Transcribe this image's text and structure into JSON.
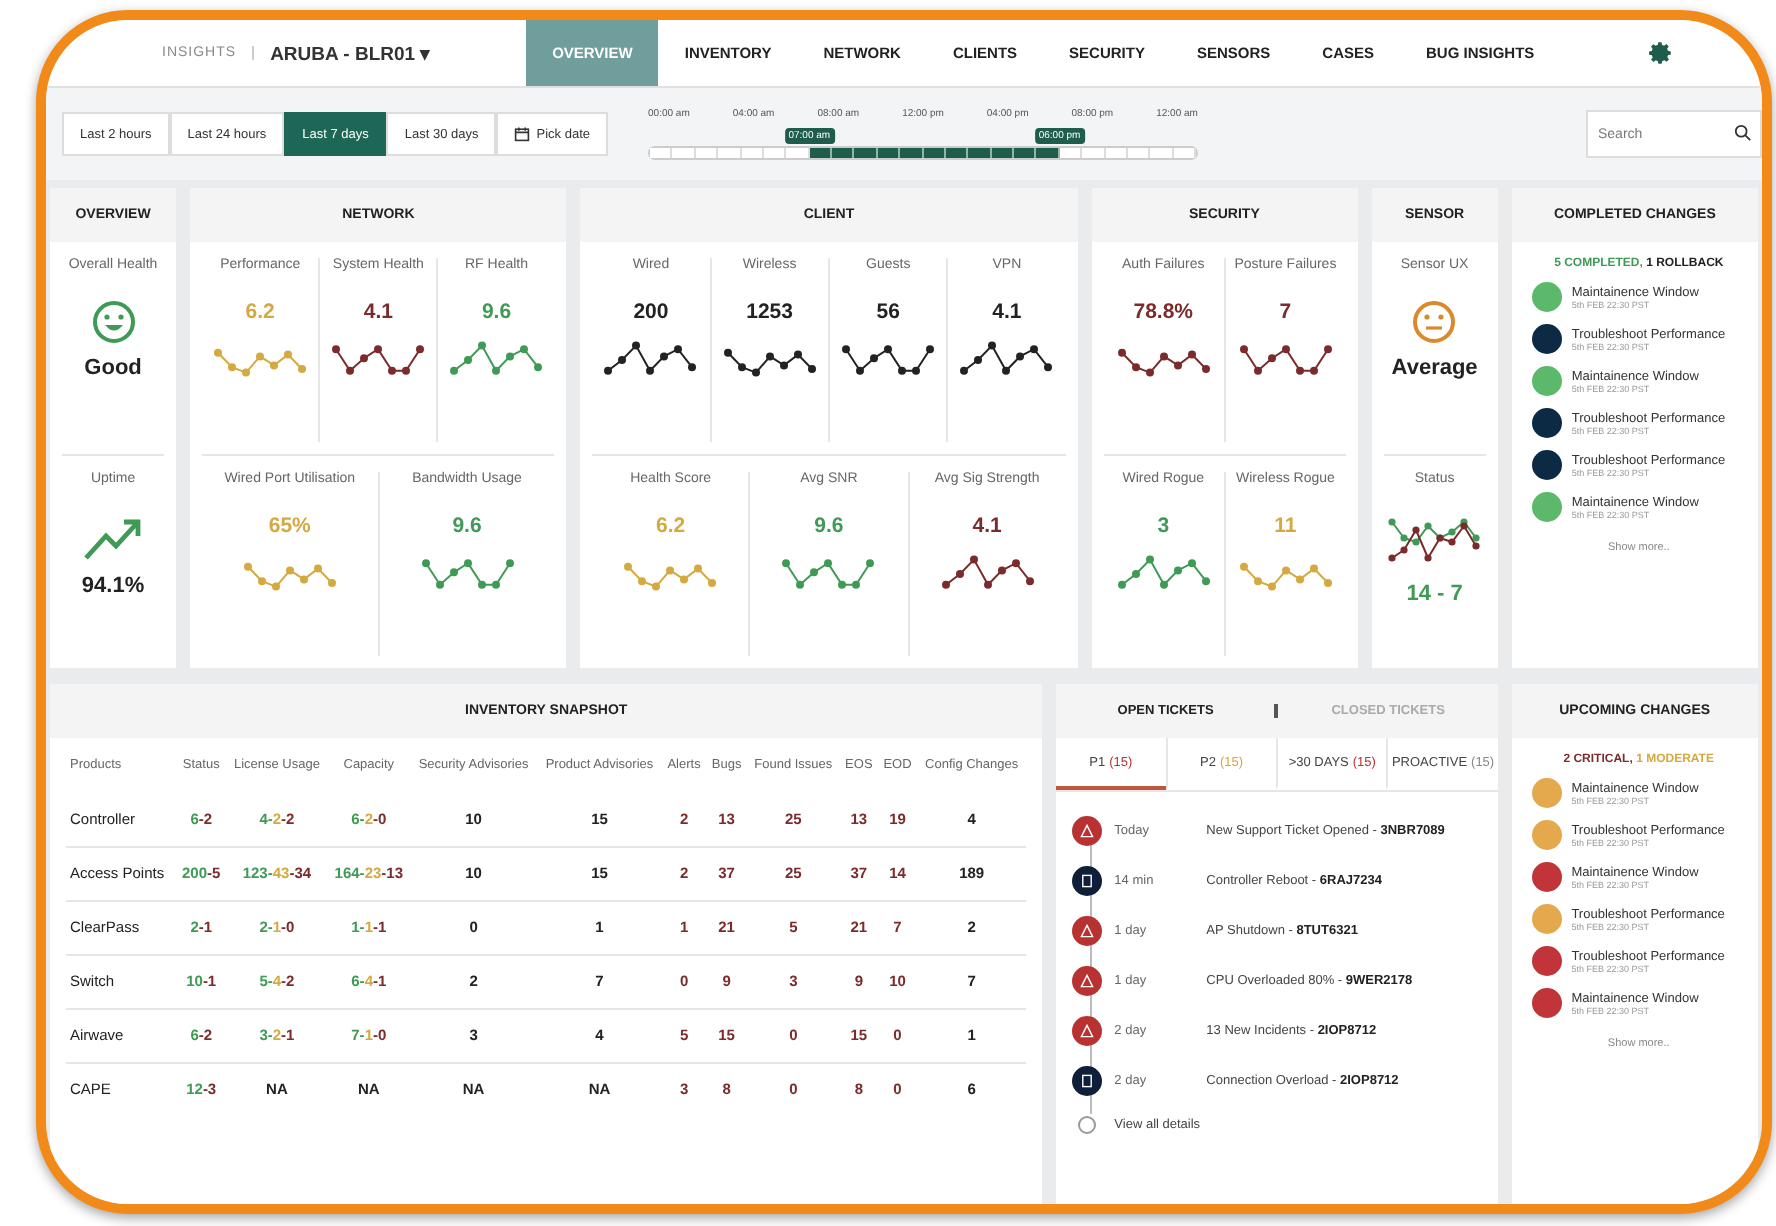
{
  "header": {
    "logo": "INSIGHTS",
    "site": "ARUBA - BLR01 ▾",
    "nav": [
      {
        "label": "OVERVIEW",
        "selected": true
      },
      {
        "label": "INVENTORY",
        "selected": false
      },
      {
        "label": "NETWORK",
        "selected": false
      },
      {
        "label": "CLIENTS",
        "selected": false
      },
      {
        "label": "SECURITY",
        "selected": false
      },
      {
        "label": "SENSORS",
        "selected": false
      },
      {
        "label": "CASES",
        "selected": false
      },
      {
        "label": "BUG INSIGHTS",
        "selected": false
      }
    ]
  },
  "toolbar": {
    "ranges": [
      {
        "label": "Last 2 hours",
        "selected": false
      },
      {
        "label": "Last 24 hours",
        "selected": false
      },
      {
        "label": "Last 7 days",
        "selected": true
      },
      {
        "label": "Last 30 days",
        "selected": false
      }
    ],
    "pick_date": "Pick date",
    "timeline": {
      "labels": [
        "00:00 am",
        "04:00 am",
        "08:00 am",
        "12:00 pm",
        "04:00 pm",
        "08:00 pm",
        "12:00 am"
      ],
      "start": "07:00 am",
      "end": "06:00 pm",
      "slots": [
        {
          "selected": false
        },
        {
          "selected": false
        },
        {
          "selected": false
        },
        {
          "selected": false
        },
        {
          "selected": false
        },
        {
          "selected": false
        },
        {
          "selected": false
        },
        {
          "selected": true
        },
        {
          "selected": true
        },
        {
          "selected": true
        },
        {
          "selected": true
        },
        {
          "selected": true
        },
        {
          "selected": true
        },
        {
          "selected": true
        },
        {
          "selected": true
        },
        {
          "selected": true
        },
        {
          "selected": true
        },
        {
          "selected": true
        },
        {
          "selected": false
        },
        {
          "selected": false
        },
        {
          "selected": false
        },
        {
          "selected": false
        },
        {
          "selected": false
        },
        {
          "selected": false
        }
      ]
    },
    "search": {
      "placeholder": "Search"
    }
  },
  "cards": [
    {
      "title": "OVERVIEW",
      "sections": [
        {
          "metrics": [
            {
              "label": "Overall Health",
              "kind": "face-happy",
              "color": "#3f9a55",
              "value": "Good"
            }
          ]
        },
        {
          "metrics": [
            {
              "label": "Uptime",
              "kind": "trend",
              "color": "#3f9a55",
              "value": "94.1%"
            }
          ]
        }
      ]
    },
    {
      "title": "NETWORK",
      "sections": [
        {
          "metrics": [
            {
              "label": "Performance",
              "kind": "spark",
              "color": "#d4a93f",
              "value": "6.2"
            },
            {
              "label": "System Health",
              "kind": "spark",
              "color": "#7b2b2b",
              "value": "4.1"
            },
            {
              "label": "RF Health",
              "kind": "spark",
              "color": "#3f9a55",
              "value": "9.6"
            }
          ]
        },
        {
          "metrics": [
            {
              "label": "Wired Port Utilisation",
              "kind": "spark",
              "color": "#d4a93f",
              "value": "65%"
            },
            {
              "label": "Bandwidth Usage",
              "kind": "spark",
              "color": "#3f9a55",
              "value": "9.6"
            }
          ]
        }
      ]
    },
    {
      "title": "CLIENT",
      "sections": [
        {
          "metrics": [
            {
              "label": "Wired",
              "kind": "spark",
              "color": "#222222",
              "value": "200"
            },
            {
              "label": "Wireless",
              "kind": "spark",
              "color": "#222222",
              "value": "1253"
            },
            {
              "label": "Guests",
              "kind": "spark",
              "color": "#222222",
              "value": "56"
            },
            {
              "label": "VPN",
              "kind": "spark",
              "color": "#222222",
              "value": "4.1"
            }
          ]
        },
        {
          "metrics": [
            {
              "label": "Health Score",
              "kind": "spark",
              "color": "#d4a93f",
              "value": "6.2"
            },
            {
              "label": "Avg SNR",
              "kind": "spark",
              "color": "#3f9a55",
              "value": "9.6"
            },
            {
              "label": "Avg Sig Strength",
              "kind": "spark",
              "color": "#7b2b2b",
              "value": "4.1"
            }
          ]
        }
      ]
    },
    {
      "title": "SECURITY",
      "sections": [
        {
          "metrics": [
            {
              "label": "Auth Failures",
              "kind": "spark",
              "color": "#7b2b2b",
              "value": "78.8%"
            },
            {
              "label": "Posture Failures",
              "kind": "spark",
              "color": "#7b2b2b",
              "value": "7"
            }
          ]
        },
        {
          "metrics": [
            {
              "label": "Wired Rogue",
              "kind": "spark",
              "color": "#3f9a55",
              "value": "3"
            },
            {
              "label": "Wireless Rogue",
              "kind": "spark",
              "color": "#d4a93f",
              "value": "11"
            }
          ]
        }
      ]
    },
    {
      "title": "SENSOR",
      "sections": [
        {
          "metrics": [
            {
              "label": "Sensor UX",
              "kind": "face-neutral",
              "color": "#d98a2b",
              "value": "Average"
            }
          ]
        },
        {
          "metrics": [
            {
              "label": "Status",
              "kind": "dual",
              "color": "#3f9a55",
              "value": "14 - 7"
            }
          ]
        }
      ]
    }
  ],
  "completed_changes": {
    "title": "COMPLETED CHANGES",
    "summary": [
      {
        "text": "5 COMPLETED,",
        "color": "#3f9a55"
      },
      {
        "text": "1 ROLLBACK",
        "color": "#222222"
      }
    ],
    "items": [
      {
        "title": "Maintainence Window",
        "time": "5th FEB 22:30 PST",
        "color": "#5cb86a"
      },
      {
        "title": "Troubleshoot Performance",
        "time": "5th FEB 22:30 PST",
        "color": "#0d2a45"
      },
      {
        "title": "Maintainence Window",
        "time": "5th FEB 22:30 PST",
        "color": "#5cb86a"
      },
      {
        "title": "Troubleshoot Performance",
        "time": "5th FEB 22:30 PST",
        "color": "#0d2a45"
      },
      {
        "title": "Troubleshoot Performance",
        "time": "5th FEB 22:30 PST",
        "color": "#0d2a45"
      },
      {
        "title": "Maintainence Window",
        "time": "5th FEB 22:30 PST",
        "color": "#5cb86a"
      }
    ],
    "more": "Show more.."
  },
  "inventory": {
    "title": "INVENTORY SNAPSHOT",
    "columns": [
      {
        "label": "Products"
      },
      {
        "label": "Status"
      },
      {
        "label": "License Usage"
      },
      {
        "label": "Capacity"
      },
      {
        "label": "Security Advisories"
      },
      {
        "label": "Product Advisories"
      },
      {
        "label": "Alerts",
        "color": "#7b2b2b"
      },
      {
        "label": "Bugs",
        "color": "#7b2b2b"
      },
      {
        "label": "Found Issues",
        "color": "#7b2b2b"
      },
      {
        "label": "EOS",
        "color": "#7b2b2b"
      },
      {
        "label": "EOD",
        "color": "#7b2b2b"
      },
      {
        "label": "Config Changes"
      }
    ],
    "rows": [
      [
        "Controller",
        [
          {
            "text": "6",
            "color": "#3f9a55"
          },
          {
            "text": "-2",
            "color": "#7b2b2b"
          }
        ],
        [
          {
            "text": "4-",
            "color": "#3f9a55"
          },
          {
            "text": "2",
            "color": "#d4a93f"
          },
          {
            "text": "-2",
            "color": "#7b2b2b"
          }
        ],
        [
          {
            "text": "6-",
            "color": "#3f9a55"
          },
          {
            "text": "2",
            "color": "#d4a93f"
          },
          {
            "text": "-0",
            "color": "#7b2b2b"
          }
        ],
        "10",
        "15",
        "2",
        "13",
        "25",
        "13",
        "19",
        "4"
      ],
      [
        "Access Points",
        [
          {
            "text": "200",
            "color": "#3f9a55"
          },
          {
            "text": "-5",
            "color": "#7b2b2b"
          }
        ],
        [
          {
            "text": "123-",
            "color": "#3f9a55"
          },
          {
            "text": "43",
            "color": "#d4a93f"
          },
          {
            "text": "-34",
            "color": "#7b2b2b"
          }
        ],
        [
          {
            "text": "164-",
            "color": "#3f9a55"
          },
          {
            "text": "23",
            "color": "#d4a93f"
          },
          {
            "text": "-13",
            "color": "#7b2b2b"
          }
        ],
        "10",
        "15",
        "2",
        "37",
        "25",
        "37",
        "14",
        "189"
      ],
      [
        "ClearPass",
        [
          {
            "text": "2",
            "color": "#3f9a55"
          },
          {
            "text": "-1",
            "color": "#7b2b2b"
          }
        ],
        [
          {
            "text": "2-",
            "color": "#3f9a55"
          },
          {
            "text": "1",
            "color": "#d4a93f"
          },
          {
            "text": "-0",
            "color": "#7b2b2b"
          }
        ],
        [
          {
            "text": "1-",
            "color": "#3f9a55"
          },
          {
            "text": "1",
            "color": "#d4a93f"
          },
          {
            "text": "-1",
            "color": "#7b2b2b"
          }
        ],
        "0",
        "1",
        "1",
        "21",
        "5",
        "21",
        "7",
        "2"
      ],
      [
        "Switch",
        [
          {
            "text": "10",
            "color": "#3f9a55"
          },
          {
            "text": "-1",
            "color": "#7b2b2b"
          }
        ],
        [
          {
            "text": "5-",
            "color": "#3f9a55"
          },
          {
            "text": "4",
            "color": "#d4a93f"
          },
          {
            "text": "-2",
            "color": "#7b2b2b"
          }
        ],
        [
          {
            "text": "6-",
            "color": "#3f9a55"
          },
          {
            "text": "4",
            "color": "#d4a93f"
          },
          {
            "text": "-1",
            "color": "#7b2b2b"
          }
        ],
        "2",
        "7",
        "0",
        "9",
        "3",
        "9",
        "10",
        "7"
      ],
      [
        "Airwave",
        [
          {
            "text": "6",
            "color": "#3f9a55"
          },
          {
            "text": "-2",
            "color": "#7b2b2b"
          }
        ],
        [
          {
            "text": "3-",
            "color": "#3f9a55"
          },
          {
            "text": "2",
            "color": "#d4a93f"
          },
          {
            "text": "-1",
            "color": "#7b2b2b"
          }
        ],
        [
          {
            "text": "7-",
            "color": "#3f9a55"
          },
          {
            "text": "1",
            "color": "#d4a93f"
          },
          {
            "text": "-0",
            "color": "#7b2b2b"
          }
        ],
        "3",
        "4",
        "5",
        "15",
        "0",
        "15",
        "0",
        "1"
      ],
      [
        "CAPE",
        [
          {
            "text": "12",
            "color": "#3f9a55"
          },
          {
            "text": "-3",
            "color": "#7b2b2b"
          }
        ],
        "NA",
        "NA",
        "NA",
        "NA",
        "3",
        "8",
        "0",
        "8",
        "0",
        "6"
      ]
    ]
  },
  "tickets": {
    "tabs": [
      {
        "label": "OPEN TICKETS",
        "selected": true
      },
      {
        "label": "CLOSED TICKETS",
        "selected": false
      }
    ],
    "filters": [
      {
        "label": "P1",
        "count": "(15)",
        "color": "#b83232",
        "selected": true
      },
      {
        "label": "P2",
        "count": "(15)",
        "color": "#d4a93f",
        "selected": false
      },
      {
        "label": ">30 DAYS",
        "count": "(15)",
        "color": "#b83232",
        "selected": false
      },
      {
        "label": "PROACTIVE",
        "count": "(15)",
        "color": "#888888",
        "selected": false
      }
    ],
    "items": [
      {
        "kind": "alert",
        "time": "Today",
        "text": "New Support Ticket Opened - **3NBR7089**"
      },
      {
        "kind": "doc",
        "time": "14 min",
        "text": "Controller Reboot - **6RAJ7234**"
      },
      {
        "kind": "alert",
        "time": "1 day",
        "text": "AP Shutdown - **8TUT6321**"
      },
      {
        "kind": "alert",
        "time": "1 day",
        "text": "CPU Overloaded 80% - **9WER2178**"
      },
      {
        "kind": "alert",
        "time": "2 day",
        "text": "13 New Incidents - **2IOP8712**"
      },
      {
        "kind": "doc",
        "time": "2 day",
        "text": "Connection Overload - **2IOP8712**"
      }
    ],
    "view_all": "View all details"
  },
  "upcoming_changes": {
    "title": "UPCOMING CHANGES",
    "summary": [
      {
        "text": "2 CRITICAL,",
        "color": "#7b2b2b"
      },
      {
        "text": "1 MODERATE",
        "color": "#d4a93f"
      }
    ],
    "items": [
      {
        "title": "Maintainence Window",
        "time": "5th FEB 22:30 PST",
        "color": "#e3a94c"
      },
      {
        "title": "Troubleshoot Performance",
        "time": "5th FEB 22:30 PST",
        "color": "#e3a94c"
      },
      {
        "title": "Maintainence Window",
        "time": "5th FEB 22:30 PST",
        "color": "#c0343a"
      },
      {
        "title": "Troubleshoot Performance",
        "time": "5th FEB 22:30 PST",
        "color": "#e3a94c"
      },
      {
        "title": "Troubleshoot Performance",
        "time": "5th FEB 22:30 PST",
        "color": "#c0343a"
      },
      {
        "title": "Maintainence Window",
        "time": "5th FEB 22:30 PST",
        "color": "#c0343a"
      }
    ],
    "more": "Show more.."
  }
}
